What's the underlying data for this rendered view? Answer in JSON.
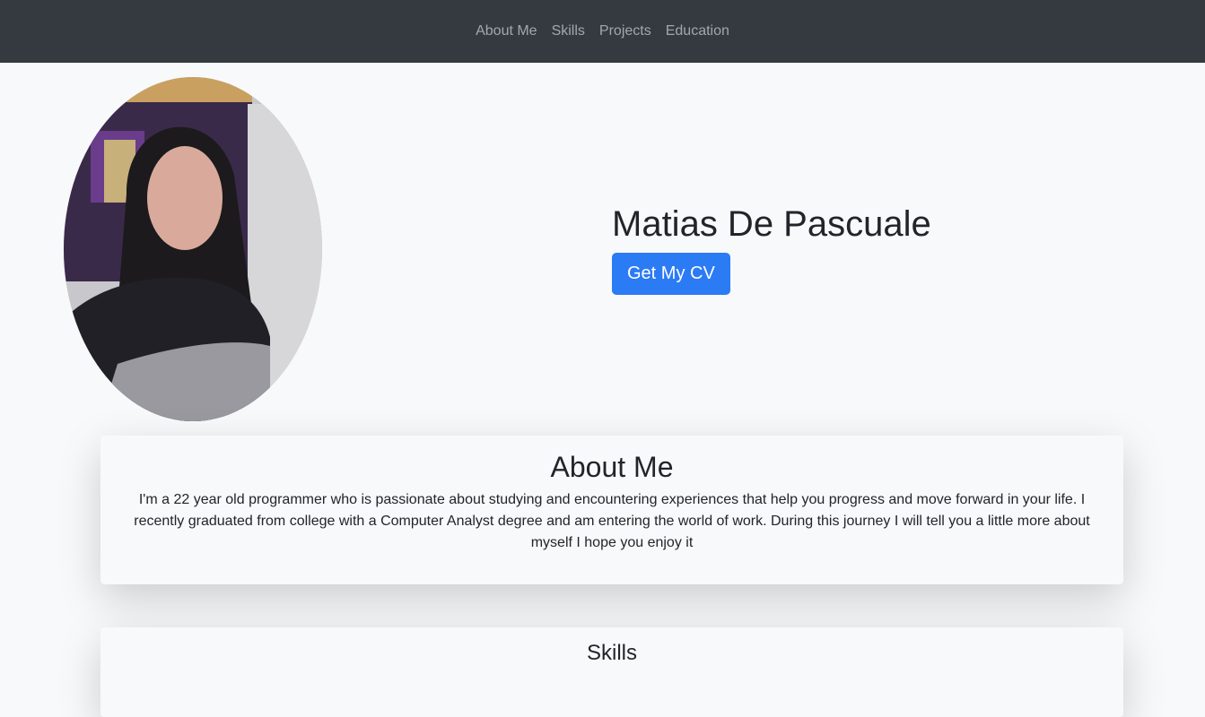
{
  "nav": {
    "items": [
      {
        "label": "About Me"
      },
      {
        "label": "Skills"
      },
      {
        "label": "Projects"
      },
      {
        "label": "Education"
      }
    ]
  },
  "hero": {
    "name": "Matias De Pascuale",
    "cv_button": "Get My CV"
  },
  "about": {
    "title": "About Me",
    "text": "I'm a 22 year old programmer who is passionate about studying and encountering experiences that help you progress and move forward in your life. I recently graduated from college with a Computer Analyst degree and am entering the world of work. During this journey I will tell you a little more about myself I hope you enjoy it"
  },
  "skills": {
    "title": "Skills"
  },
  "colors": {
    "navbar": "#343a40",
    "button": "#2b7bf5",
    "background": "#f8f9fa"
  }
}
